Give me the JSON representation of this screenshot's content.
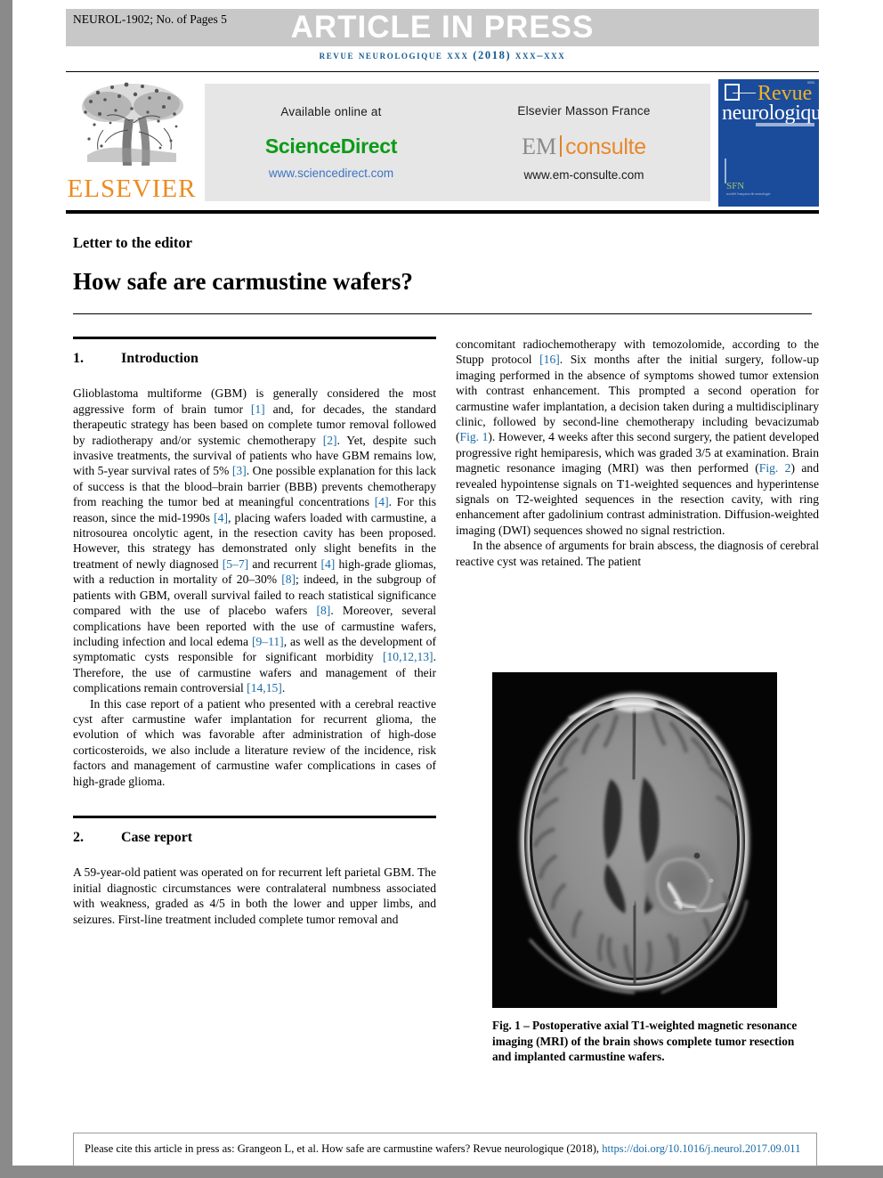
{
  "header": {
    "manuscript_id": "NEUROL-1902; No. of Pages 5",
    "article_in_press": "ARTICLE IN PRESS",
    "running_head": "revue neurologique xxx (2018) xxx–xxx"
  },
  "masthead": {
    "elsevier_wordmark": "ELSEVIER",
    "available_online_label": "Available online at",
    "sciencedirect_logo": "ScienceDirect",
    "sciencedirect_url": "www.sciencedirect.com",
    "elsevier_masson_label": "Elsevier Masson France",
    "em_logo_prefix": "EM",
    "em_logo_suffix": "consulte",
    "em_url": "www.em-consulte.com",
    "cover_title_line1": "Revue",
    "cover_title_line2": "neurologique"
  },
  "article": {
    "type": "Letter to the editor",
    "title": "How safe are carmustine wafers?"
  },
  "sections": {
    "intro": {
      "number": "1.",
      "title": "Introduction"
    },
    "case": {
      "number": "2.",
      "title": "Case report"
    }
  },
  "body": {
    "intro_p1_a": "Glioblastoma multiforme (GBM) is generally considered the most aggressive form of brain tumor ",
    "intro_r1": "[1]",
    "intro_p1_b": " and, for decades, the standard therapeutic strategy has been based on complete tumor removal followed by radiotherapy and/or systemic chemotherapy ",
    "intro_r2": "[2]",
    "intro_p1_c": ". Yet, despite such invasive treatments, the survival of patients who have GBM remains low, with 5-year survival rates of 5% ",
    "intro_r3": "[3]",
    "intro_p1_d": ". One possible explanation for this lack of success is that the blood–brain barrier (BBB) prevents chemotherapy from reaching the tumor bed at meaningful concentrations ",
    "intro_r4": "[4]",
    "intro_p1_e": ". For this reason, since the mid-1990s ",
    "intro_r5": "[4]",
    "intro_p1_f": ", placing wafers loaded with carmustine, a nitrosourea oncolytic agent, in the resection cavity has been proposed. However, this strategy has demonstrated only slight benefits in the treatment of newly diagnosed ",
    "intro_r6": "[5–7]",
    "intro_p1_g": " and recurrent ",
    "intro_r7": "[4]",
    "intro_p1_h": " high-grade gliomas, with a reduction in mortality of 20–30% ",
    "intro_r8": "[8]",
    "intro_p1_i": "; indeed, in the subgroup of patients with GBM, overall survival failed to reach statistical significance compared with the use of placebo wafers ",
    "intro_r9": "[8]",
    "intro_p1_j": ". Moreover, several complications have been reported with the use of carmustine wafers, including infection and local edema ",
    "intro_r10": "[9–11]",
    "intro_p1_k": ", as well as the development of symptomatic cysts responsible for significant morbidity ",
    "intro_r11": "[10,12,13]",
    "intro_p1_l": ". Therefore, the use of carmustine wafers and management of their complications remain controversial ",
    "intro_r12": "[14,15]",
    "intro_p1_m": ".",
    "intro_p2": "In this case report of a patient who presented with a cerebral reactive cyst after carmustine wafer implantation for recurrent glioma, the evolution of which was favorable after administration of high-dose corticosteroids, we also include a literature review of the incidence, risk factors and management of carmustine wafer complications in cases of high-grade glioma.",
    "case_p1": "A 59-year-old patient was operated on for recurrent left parietal GBM. The initial diagnostic circumstances were contralateral numbness associated with weakness, graded as 4/5 in both the lower and upper limbs, and seizures. First-line treatment included complete tumor removal and",
    "right_p1_a": "concomitant radiochemotherapy with temozolomide, according to the Stupp protocol ",
    "right_r16": "[16]",
    "right_p1_b": ". Six months after the initial surgery, follow-up imaging performed in the absence of symptoms showed tumor extension with contrast enhancement. This prompted a second operation for carmustine wafer implantation, a decision taken during a multidisciplinary clinic, followed by second-line chemotherapy including bevacizumab (",
    "right_fig1": "Fig. 1",
    "right_p1_c": "). However, 4 weeks after this second surgery, the patient developed progressive right hemiparesis, which was graded 3/5 at examination. Brain magnetic resonance imaging (MRI) was then performed (",
    "right_fig2": "Fig. 2",
    "right_p1_d": ") and revealed hypointense signals on T1-weighted sequences and hyperintense signals on T2-weighted sequences in the resection cavity, with ring enhancement after gadolinium contrast administration. Diffusion-weighted imaging (DWI) sequences showed no signal restriction.",
    "right_p2": "In the absence of arguments for brain abscess, the diagnosis of cerebral reactive cyst was retained. The patient"
  },
  "figure": {
    "caption": "Fig. 1 – Postoperative axial T1-weighted magnetic resonance imaging (MRI) of the brain shows complete tumor resection and implanted carmustine wafers."
  },
  "footer": {
    "cite_text": "Please cite this article in press as: Grangeon L, et al. How safe are carmustine wafers? Revue neurologique (2018), ",
    "cite_doi": "https://doi.org/10.1016/j.neurol.2017.09.011"
  },
  "colors": {
    "accent_blue": "#1a6ca8",
    "running_head_blue": "#12598f",
    "elsevier_orange": "#ec8b1f",
    "sciencedirect_green": "#0a9b16",
    "em_orange": "#e8892b",
    "band_gray": "#c8c8c8",
    "banner_gray": "#e6e6e6",
    "cover_blue": "#1b4c9b"
  }
}
